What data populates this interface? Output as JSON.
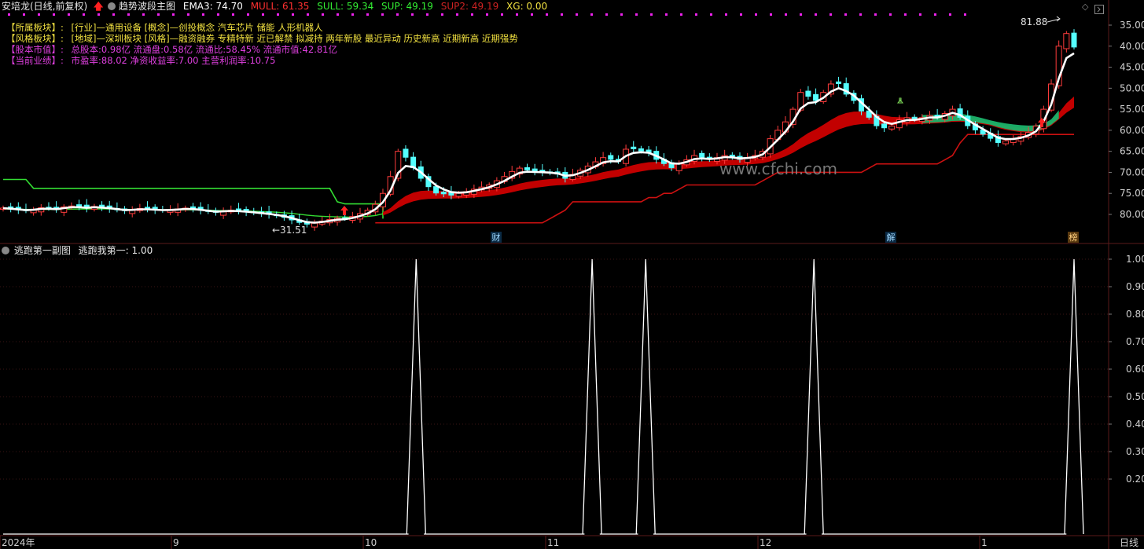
{
  "main_header": {
    "stock_title": "安培龙(日线,前复权)",
    "indicator_name": "趋势波段主图",
    "ema3": "EMA3: 74.70",
    "mull": "MULL: 61.35",
    "sull": "SULL: 59.34",
    "sup": "SUP: 49.19",
    "sup2": "SUP2: 49.19",
    "xg": "XG: 0.00"
  },
  "info": [
    {
      "label": "【所属板块】:",
      "text": "[行业]—通用设备 [概念]—创投概念 汽车芯片 储能 人形机器人",
      "color": "#f0e040"
    },
    {
      "label": "【风格板块】:",
      "text": "[地域]—深圳板块 [风格]—融资融券 专精特新 近已解禁 拟减持 两年新股 最近异动 历史新高 近期新高 近期强势",
      "color": "#f0e040"
    },
    {
      "label": "【股本市值】:",
      "text": "总股本:0.98亿 流通盘:0.58亿 流通比:58.45% 流通市值:42.81亿",
      "color": "#e040e0"
    },
    {
      "label": "【当前业绩】:",
      "text": "市盈率:88.02 净资收益率:7.00 主营利润率:10.75",
      "color": "#e040e0"
    }
  ],
  "watermark": "www.cfchi.com",
  "annotations": {
    "high_label": "81.88",
    "low_label": "←31.51",
    "event_cai": "财",
    "event_jie": "解",
    "event_bang": "榜"
  },
  "price_axis": [
    "80.00",
    "75.00",
    "70.00",
    "65.00",
    "60.00",
    "55.00",
    "50.00",
    "45.00",
    "40.00",
    "35.00"
  ],
  "sub_header": {
    "name": "逃跑第一副图",
    "value": "逃跑我第一: 1.00"
  },
  "sub_axis": [
    "1.00",
    "0.90",
    "0.80",
    "0.70",
    "0.60",
    "0.50",
    "0.40",
    "0.30",
    "0.20"
  ],
  "date_axis": [
    "2024年",
    "9",
    "10",
    "11",
    "12",
    "1"
  ],
  "period_label": "日线",
  "colors": {
    "up": "#ff3c3c",
    "down": "#54ffff",
    "ema": "#ffffff",
    "band_red": "#cc0000",
    "band_green": "#1bb36a",
    "sup": "#cc1111",
    "sull_line": "#33dd33",
    "dots": "#ee22ee",
    "grid": "#5a1a1a"
  },
  "chart_data": [
    {
      "type": "candlestick",
      "title": "趋势波段主图",
      "ylim": [
        31,
        83
      ],
      "yticks": [
        35,
        40,
        45,
        50,
        55,
        60,
        65,
        70,
        75,
        80
      ],
      "high_marker": 81.88,
      "low_marker": 31.51,
      "ema3_last": 74.7,
      "mull_last": 61.35,
      "sull_last": 59.34,
      "sup_last": 49.19,
      "sup2_last": 49.19,
      "x_labels": [
        "2024年",
        "9",
        "10",
        "11",
        "12",
        "1"
      ],
      "closes": [
        36.5,
        36.2,
        36.0,
        35.8,
        36.2,
        36.6,
        36.4,
        36.1,
        36.8,
        37.0,
        36.7,
        36.4,
        36.9,
        36.5,
        36.3,
        36.0,
        35.8,
        36.1,
        36.4,
        36.2,
        36.0,
        35.9,
        36.1,
        36.3,
        36.5,
        36.2,
        35.9,
        35.6,
        35.4,
        35.8,
        36.0,
        35.7,
        35.5,
        35.3,
        35.1,
        34.9,
        34.6,
        34.2,
        33.6,
        33.0,
        32.6,
        32.9,
        33.4,
        33.8,
        34.1,
        34.0,
        34.5,
        35.2,
        36.0,
        37.4,
        40.0,
        44.0,
        50.0,
        48.5,
        46.0,
        43.5,
        41.5,
        40.0,
        39.8,
        39.5,
        40.0,
        40.4,
        41.0,
        41.5,
        42.0,
        43.0,
        44.0,
        45.2,
        46.0,
        45.5,
        45.0,
        45.0,
        44.8,
        44.5,
        43.5,
        44.5,
        45.5,
        46.5,
        47.5,
        48.5,
        48.0,
        47.5,
        50.5,
        50.5,
        50.0,
        49.5,
        48.0,
        47.0,
        46.0,
        47.0,
        48.0,
        49.0,
        48.5,
        48.0,
        48.5,
        49.0,
        48.5,
        48.0,
        48.5,
        49.0,
        50.0,
        53.0,
        55.0,
        57.0,
        60.0,
        64.0,
        63.0,
        62.0,
        64.0,
        66.0,
        66.0,
        63.5,
        62.0,
        59.5,
        58.0,
        56.0,
        55.5,
        56.0,
        57.5,
        58.0,
        57.5,
        58.0,
        58.5,
        58.0,
        59.0,
        60.0,
        58.0,
        56.0,
        55.0,
        54.0,
        53.0,
        52.0,
        52.5,
        53.0,
        53.5,
        54.5,
        56.0,
        60.0,
        66.0,
        75.0,
        78.0,
        74.7
      ]
    },
    {
      "type": "line",
      "title": "逃跑第一副图",
      "series": [
        {
          "name": "逃跑我第一",
          "values": [
            0,
            0,
            0,
            0,
            0,
            0,
            0,
            0,
            0,
            0,
            0,
            0,
            0,
            0,
            0,
            0,
            0,
            0,
            0,
            0,
            0,
            0,
            0,
            0,
            0,
            0,
            0,
            0,
            0,
            0,
            0,
            0,
            0,
            0,
            0,
            0,
            0,
            0,
            0,
            0,
            0,
            0,
            0,
            0,
            0,
            0,
            0,
            0,
            0,
            0,
            0,
            0,
            0,
            0,
            1,
            0,
            0,
            0,
            0,
            0,
            0,
            0,
            0,
            0,
            0,
            0,
            0,
            0,
            0,
            0,
            0,
            0,
            0,
            0,
            0,
            0,
            0,
            1,
            0,
            0,
            0,
            0,
            0,
            0,
            1,
            0,
            0,
            0,
            0,
            0,
            0,
            0,
            0,
            0,
            0,
            0,
            0,
            0,
            0,
            0,
            0,
            0,
            0,
            0,
            0,
            0,
            1,
            0,
            0,
            0,
            0,
            0,
            0,
            0,
            0,
            0,
            0,
            0,
            0,
            0,
            0,
            0,
            0,
            0,
            0,
            0,
            0,
            0,
            0,
            0,
            0,
            0,
            0,
            0,
            0,
            0,
            0,
            0,
            0,
            0,
            1
          ]
        }
      ],
      "ylim": [
        0,
        1
      ],
      "last_value": 1.0
    }
  ]
}
